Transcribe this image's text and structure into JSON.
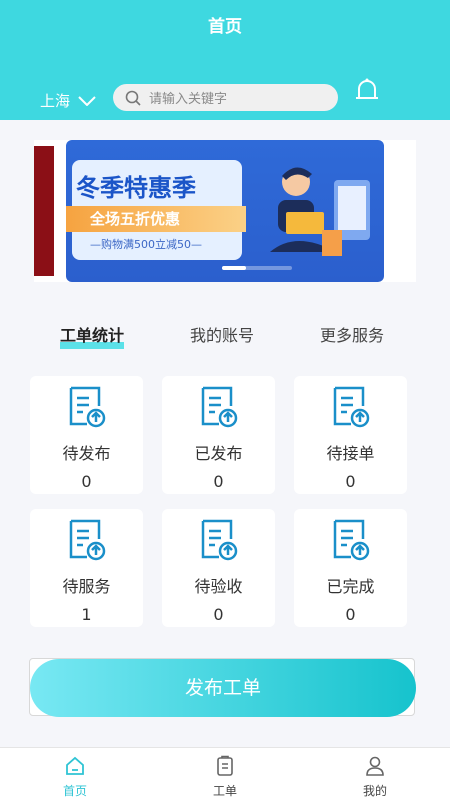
{
  "header": {
    "title": "首页",
    "city": "上海",
    "search_placeholder": "请输入关键字"
  },
  "banner": {
    "title": "冬季特惠季",
    "subtitle": "全场五折优惠",
    "note": "—购物满500立减50—"
  },
  "tabs": [
    "工单统计",
    "我的账号",
    "更多服务"
  ],
  "stats": [
    {
      "label": "待发布",
      "count": "0"
    },
    {
      "label": "已发布",
      "count": "0"
    },
    {
      "label": "待接单",
      "count": "0"
    },
    {
      "label": "待服务",
      "count": "1"
    },
    {
      "label": "待验收",
      "count": "0"
    },
    {
      "label": "已完成",
      "count": "0"
    }
  ],
  "publish_label": "发布工单",
  "tabbar": [
    "首页",
    "工单",
    "我的"
  ],
  "colors": {
    "header": "#3ed8e0",
    "accent": "#2fc4d4",
    "icon": "#1a8fc9"
  }
}
